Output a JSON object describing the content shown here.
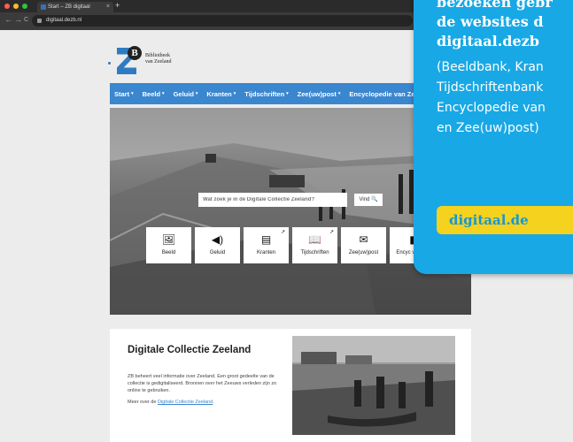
{
  "browser": {
    "tab_title": "Start – ZB digitaal",
    "tab_close": "×",
    "new_tab": "+",
    "back": "←",
    "forward": "→",
    "reload": "C",
    "url": "digitaal.dezb.nl"
  },
  "logo": {
    "mark": "B",
    "name_line1": "Bibliotheek",
    "name_line2": "van Zeeland"
  },
  "menu": {
    "items": [
      {
        "label": "Start",
        "has_caret": true
      },
      {
        "label": "Beeld",
        "has_caret": true
      },
      {
        "label": "Geluid",
        "has_caret": true
      },
      {
        "label": "Kranten",
        "has_caret": true
      },
      {
        "label": "Tijdschriften",
        "has_caret": true
      },
      {
        "label": "Zee(uw)post",
        "has_caret": true
      },
      {
        "label": "Encyclopedie van Ze",
        "has_caret": false
      }
    ],
    "caret": "▾"
  },
  "hero": {
    "search_placeholder": "Wat zoek je in de Digitale Collectie Zeeland?",
    "search_button": "Vind 🔍",
    "tiles": [
      {
        "label": "Beeld",
        "icon": "image-icon",
        "glyph": "🖼",
        "external": false
      },
      {
        "label": "Geluid",
        "icon": "speaker-icon",
        "glyph": "◀)",
        "external": false
      },
      {
        "label": "Kranten",
        "icon": "newspaper-icon",
        "glyph": "▤",
        "external": true
      },
      {
        "label": "Tijdschriften",
        "icon": "magazine-icon",
        "glyph": "📖",
        "external": true
      },
      {
        "label": "Zee(uw)post",
        "icon": "envelope-icon",
        "glyph": "✉",
        "external": false
      },
      {
        "label": "Encyc van Ze",
        "icon": "book-icon",
        "glyph": "▮",
        "external": false
      }
    ],
    "external_glyph": "↗"
  },
  "section": {
    "title": "Digitale Collectie Zeeland",
    "body": "ZB beheert veel informatie over Zeeland. Een groot gedeelte van de collectie is gedigitaliseerd. Bronnen over het Zeeuws verleden zijn zo online te gebruiken.",
    "more_prefix": "Meer over de ",
    "more_link": "Digitale Collectie Zeeland",
    "more_suffix": "."
  },
  "overlay": {
    "bold_lines": [
      "bezoeken gebr",
      "de websites d",
      "digitaal.dezb"
    ],
    "text_lines": [
      "(Beeldbank, Kran",
      "Tijdschriftenbank",
      "Encyclopedie van",
      "en Zee(uw)post)"
    ],
    "button": "digitaal.de"
  },
  "colors": {
    "accent_blue": "#3a86cf",
    "overlay_blue": "#19a8e6",
    "overlay_yellow": "#f4d21e"
  }
}
